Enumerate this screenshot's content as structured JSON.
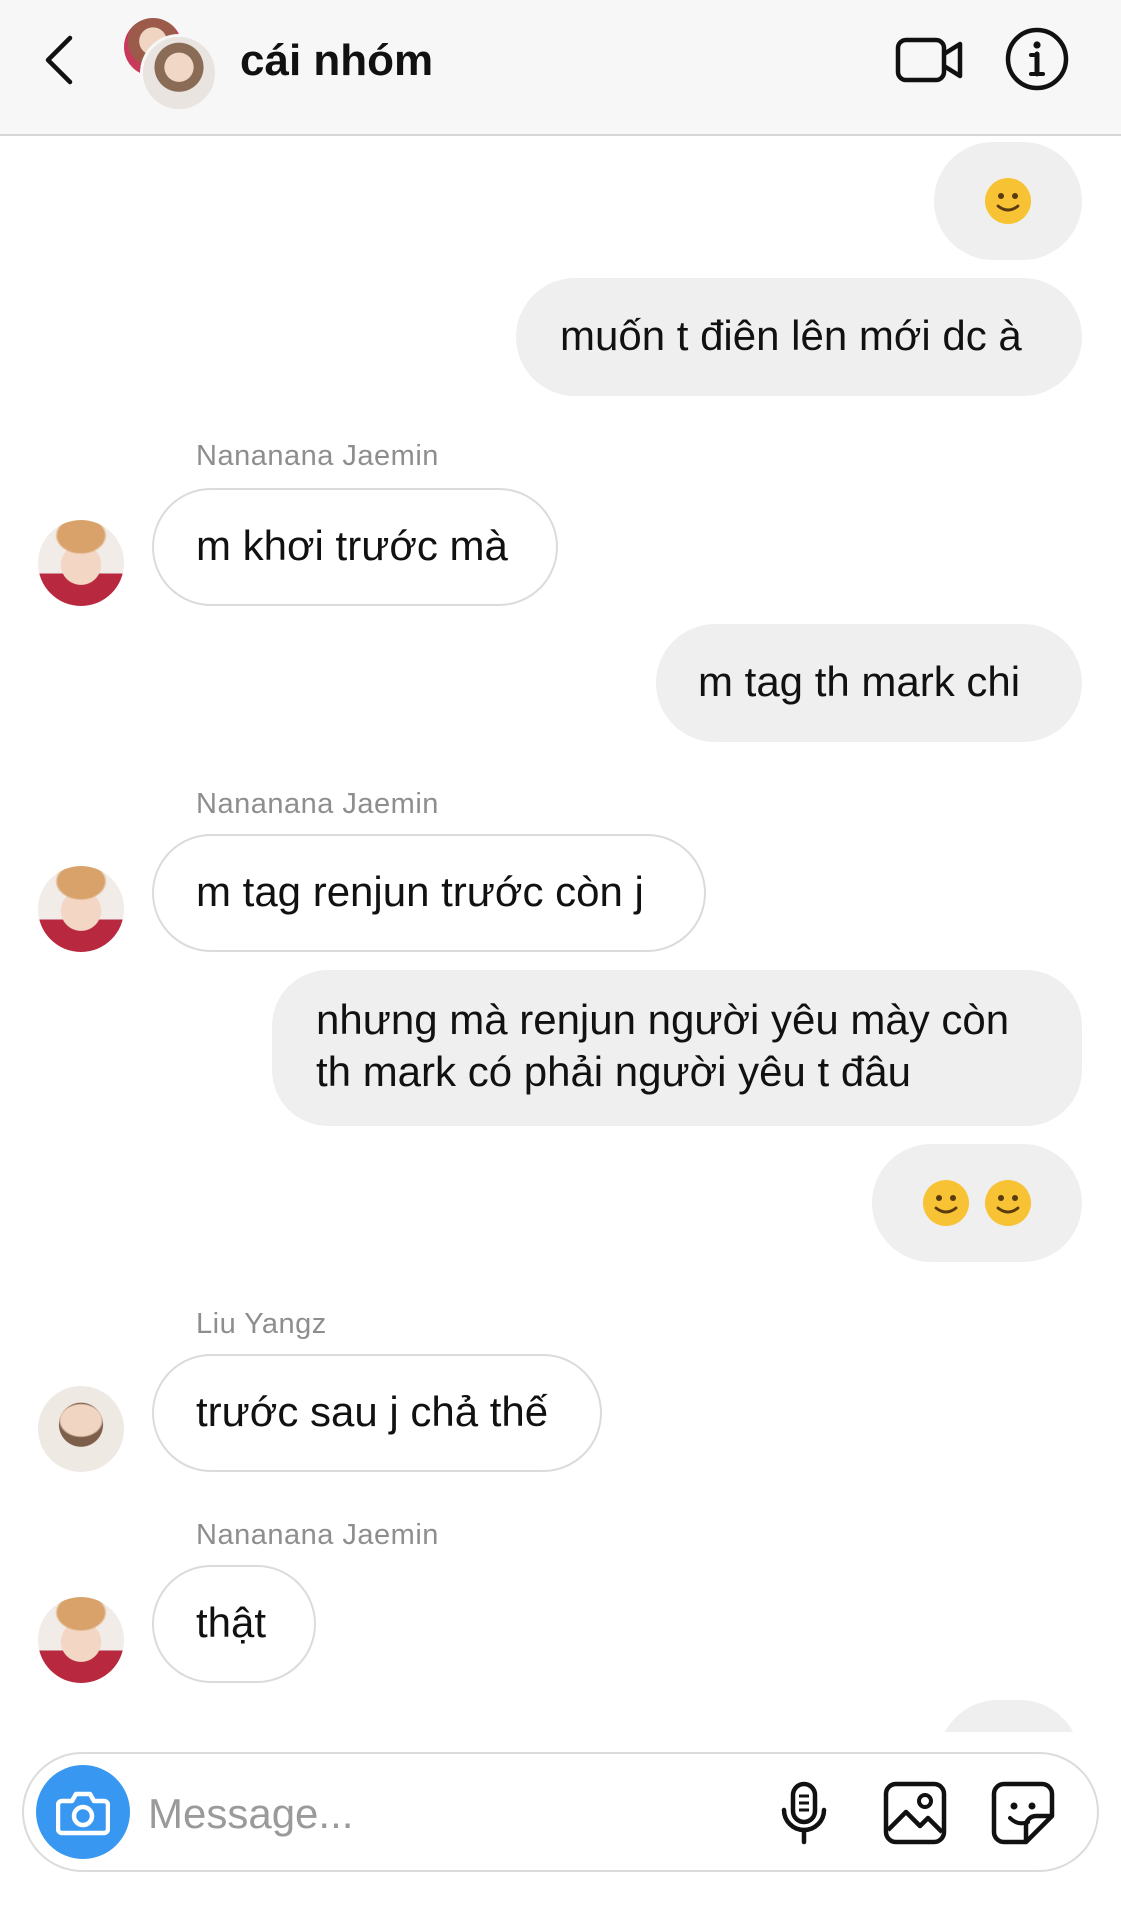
{
  "header": {
    "title": "cái nhóm",
    "back_icon": "chevron-left-icon",
    "video_icon": "video-camera-icon",
    "info_icon": "info-icon"
  },
  "messages": [
    {
      "type": "outgoing",
      "text": "🙂"
    },
    {
      "type": "outgoing",
      "text": "muốn t điên lên mới dc à"
    },
    {
      "type": "incoming",
      "sender": "Nananana Jaemin",
      "text": "m khơi trước mà"
    },
    {
      "type": "outgoing",
      "text": "m tag th mark chi"
    },
    {
      "type": "incoming",
      "sender": "Nananana Jaemin",
      "text": "m tag renjun trước còn j"
    },
    {
      "type": "outgoing",
      "lines": [
        "nhưng mà renjun người yêu mày còn",
        "th mark có phải người yêu t đâu"
      ]
    },
    {
      "type": "outgoing",
      "text": "🙂🙂"
    },
    {
      "type": "incoming",
      "sender": "Liu Yangz",
      "text": "trước sau j chả thế"
    },
    {
      "type": "incoming",
      "sender": "Nananana Jaemin",
      "text": "thật"
    }
  ],
  "composer": {
    "placeholder": "Message...",
    "camera_icon": "camera-icon",
    "mic_icon": "microphone-icon",
    "gallery_icon": "image-gallery-icon",
    "sticker_icon": "sticker-icon",
    "accent_color": "#3897f0"
  }
}
